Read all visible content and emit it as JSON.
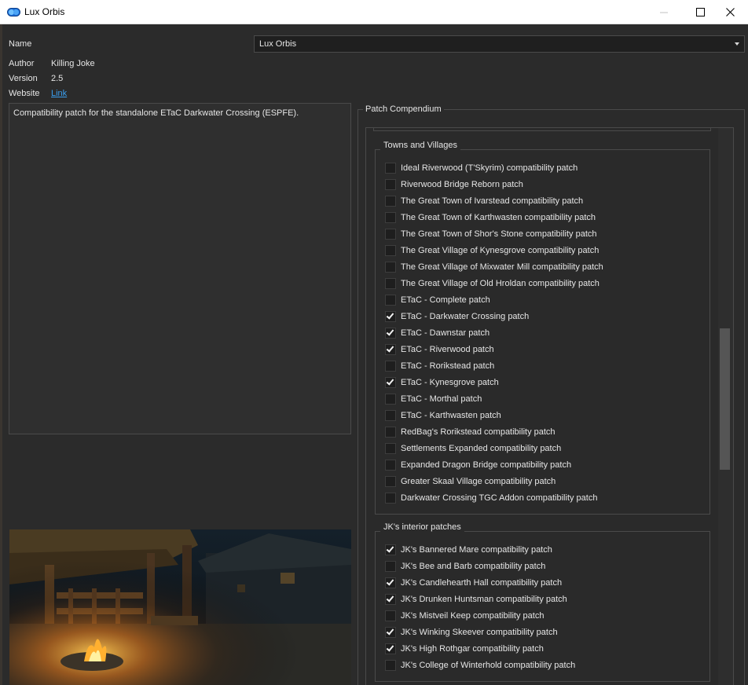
{
  "window": {
    "title": "Lux Orbis",
    "icon": "lux-orbis-app-icon",
    "minimize_label": "—",
    "maximize_label": "☐",
    "close_label": "✕"
  },
  "meta": {
    "name_label": "Name",
    "name_value": "Lux Orbis",
    "author_label": "Author",
    "author_value": "Killing Joke",
    "version_label": "Version",
    "version_value": "2.5",
    "website_label": "Website",
    "website_link": "Link"
  },
  "description": "Compatibility patch for the standalone ETaC Darkwater Crossing (ESPFE).",
  "compendium": {
    "title": "Patch Compendium",
    "groups": [
      {
        "title": "Towns and Villages",
        "items": [
          {
            "label": "Ideal Riverwood (T'Skyrim) compatibility patch",
            "checked": false
          },
          {
            "label": "Riverwood Bridge Reborn patch",
            "checked": false
          },
          {
            "label": "The Great Town of Ivarstead compatibility patch",
            "checked": false
          },
          {
            "label": "The Great Town of Karthwasten compatibility patch",
            "checked": false
          },
          {
            "label": "The Great Town of Shor's Stone compatibility patch",
            "checked": false
          },
          {
            "label": "The Great Village of Kynesgrove compatibility patch",
            "checked": false
          },
          {
            "label": "The Great Village of Mixwater Mill compatibility patch",
            "checked": false
          },
          {
            "label": "The Great Village of Old Hroldan compatibility patch",
            "checked": false
          },
          {
            "label": "ETaC - Complete patch",
            "checked": false
          },
          {
            "label": "ETaC - Darkwater Crossing patch",
            "checked": true
          },
          {
            "label": "ETaC - Dawnstar patch",
            "checked": true
          },
          {
            "label": "ETaC - Riverwood patch",
            "checked": true
          },
          {
            "label": "ETaC - Rorikstead patch",
            "checked": false
          },
          {
            "label": "ETaC - Kynesgrove patch",
            "checked": true
          },
          {
            "label": "ETaC - Morthal patch",
            "checked": false
          },
          {
            "label": "ETaC - Karthwasten patch",
            "checked": false
          },
          {
            "label": "RedBag's Rorikstead compatibility patch",
            "checked": false
          },
          {
            "label": "Settlements Expanded compatibility patch",
            "checked": false
          },
          {
            "label": "Expanded Dragon Bridge compatibility patch",
            "checked": false
          },
          {
            "label": "Greater Skaal Village compatibility patch",
            "checked": false
          },
          {
            "label": "Darkwater Crossing TGC Addon compatibility patch",
            "checked": false
          }
        ]
      },
      {
        "title": "JK's interior patches",
        "items": [
          {
            "label": "JK's Bannered Mare compatibility patch",
            "checked": true
          },
          {
            "label": "JK's Bee and Barb compatibility patch",
            "checked": false
          },
          {
            "label": "JK's Candlehearth Hall compatibility patch",
            "checked": true
          },
          {
            "label": "JK's Drunken Huntsman compatibility patch",
            "checked": true
          },
          {
            "label": "JK's Mistveil Keep compatibility patch",
            "checked": false
          },
          {
            "label": "JK's Winking Skeever compatibility patch",
            "checked": true
          },
          {
            "label": "JK's High Rothgar compatibility patch",
            "checked": true
          },
          {
            "label": "JK's College of Winterhold compatibility patch",
            "checked": false
          }
        ]
      }
    ]
  }
}
